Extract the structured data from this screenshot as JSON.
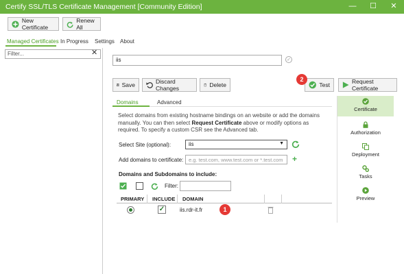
{
  "window": {
    "title": "Certify SSL/TLS Certificate Management [Community Edition]",
    "controls": [
      "—",
      "☐",
      "✕"
    ],
    "accent": "#6cb33f"
  },
  "toolbar": {
    "new_certificate": "New Certificate",
    "renew_all": "Renew All"
  },
  "main_tabs": [
    "Managed Certificates",
    "In Progress",
    "Settings",
    "About"
  ],
  "sidebar": {
    "filter_placeholder": "Filter..."
  },
  "certificate": {
    "name": "iis"
  },
  "actions": {
    "save": "Save",
    "discard": "Discard Changes",
    "delete": "Delete",
    "test": "Test",
    "request": "Request Certificate"
  },
  "badges": {
    "test_badge": "2",
    "domain_badge": "1"
  },
  "sub_tabs": [
    "Domains",
    "Advanced"
  ],
  "domains": {
    "intro_part1": "Select domains from existing hostname bindings on an website or add the domains manually. You can then select ",
    "intro_bold": "Request Certificate",
    "intro_part2": " above or modify options as required. To specify a custom CSR see the Advanced tab.",
    "select_site_label": "Select Site (optional):",
    "select_site_value": "iis",
    "add_domains_label": "Add domains to certificate:",
    "add_domains_placeholder": "e.g. test.com, www.test.com or *.test.com",
    "subdomains_header": "Domains and Subdomains to include:",
    "filter_label": "Filter:",
    "columns": [
      "PRIMARY",
      "INCLUDE",
      "DOMAIN"
    ],
    "rows": [
      {
        "domain": "iis.rdr-it.fr",
        "primary": true,
        "include": true
      }
    ]
  },
  "right_nav": [
    {
      "label": "Certificate",
      "icon": "check-circle-icon",
      "active": true
    },
    {
      "label": "Authorization",
      "icon": "lock-icon",
      "active": false
    },
    {
      "label": "Deployment",
      "icon": "copy-icon",
      "active": false
    },
    {
      "label": "Tasks",
      "icon": "gears-icon",
      "active": false
    },
    {
      "label": "Preview",
      "icon": "play-circle-icon",
      "active": false
    }
  ]
}
